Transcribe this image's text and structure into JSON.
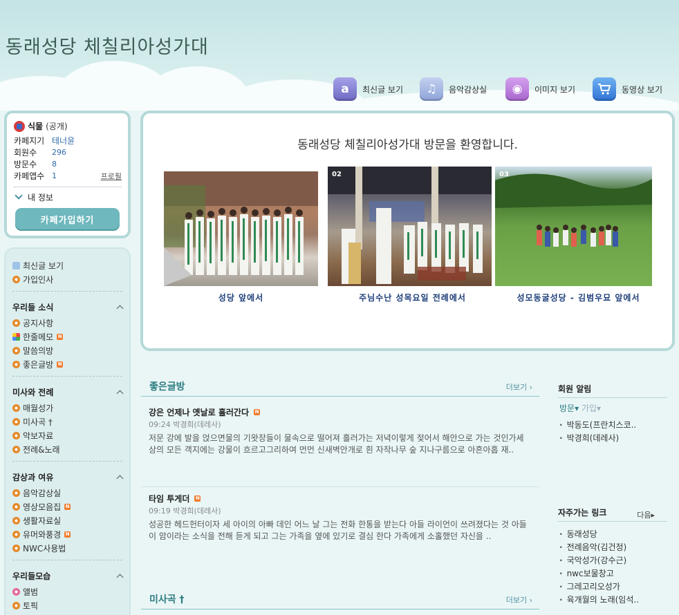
{
  "site": {
    "title": "동래성당 체칠리아성가대"
  },
  "topnav": [
    {
      "icon": "new-posts-icon",
      "glyph": "a",
      "color": "#7b78c9",
      "label": "최신글 보기"
    },
    {
      "icon": "music-note-icon",
      "glyph": "♫",
      "color": "#8fa6db",
      "label": "음악감상실"
    },
    {
      "icon": "camera-icon",
      "glyph": "◉",
      "color": "#b778d8",
      "label": "이미지 보기"
    },
    {
      "icon": "cart-icon",
      "glyph": "🛒",
      "color": "#4f8fe0",
      "label": "동영상 보기"
    }
  ],
  "profile": {
    "name": "식물",
    "visibility": "(공개)",
    "rows": [
      {
        "k": "카페지기",
        "v": "테너윤"
      },
      {
        "k": "회원수",
        "v": "296"
      },
      {
        "k": "방문수",
        "v": "8"
      },
      {
        "k": "카페앱수",
        "v": "1"
      }
    ],
    "profile_link": "프로필",
    "my_info": "내 정보",
    "join_label": "카페가입하기"
  },
  "menu": {
    "top_items": [
      {
        "label": "최신글 보기",
        "icon": "blue"
      },
      {
        "label": "가입인사",
        "icon": "orange"
      }
    ],
    "sections": [
      {
        "title": "우리들 소식",
        "items": [
          {
            "label": "공지사항",
            "icon": "orange",
            "new": false
          },
          {
            "label": "한줄메모",
            "icon": "multi",
            "new": true
          },
          {
            "label": "말씀의방",
            "icon": "orange",
            "new": false
          },
          {
            "label": "좋은글방",
            "icon": "orange",
            "new": true
          }
        ]
      },
      {
        "title": "미사와 전례",
        "items": [
          {
            "label": "매월성가",
            "icon": "orange",
            "new": false
          },
          {
            "label": "미사곡 †",
            "icon": "orange",
            "new": false
          },
          {
            "label": "악보자료",
            "icon": "orange",
            "new": false
          },
          {
            "label": "전례&노래",
            "icon": "orange",
            "new": false
          }
        ]
      },
      {
        "title": "감상과 여유",
        "items": [
          {
            "label": "음악감상실",
            "icon": "orange",
            "new": false
          },
          {
            "label": "영상모음집",
            "icon": "orange",
            "new": true
          },
          {
            "label": "생활자료실",
            "icon": "orange",
            "new": false
          },
          {
            "label": "유머와풍경",
            "icon": "orange",
            "new": true
          },
          {
            "label": "NWC사용법",
            "icon": "orange",
            "new": false
          }
        ]
      },
      {
        "title": "우리들모습",
        "items": [
          {
            "label": "앨범",
            "icon": "pink",
            "new": false
          },
          {
            "label": "토픽",
            "icon": "orange",
            "new": false
          }
        ]
      }
    ],
    "new_badge": "N"
  },
  "welcome": {
    "title": "동래성당 체칠리아성가대 방문을 환영합니다.",
    "photos": [
      {
        "num": "",
        "caption": "성당 앞에서"
      },
      {
        "num": "02",
        "caption": "주님수난 성목요일 전례에서"
      },
      {
        "num": "03",
        "caption": "성모동굴성당 - 김범우묘 앞에서"
      }
    ]
  },
  "boards": [
    {
      "title": "좋은글방",
      "more": "더보기 ›",
      "posts": [
        {
          "title": "강은 언제나 옛날로 흘러간다",
          "meta": "09:24  박경희(데레사)",
          "body": "저문 강에 발을 얹으면물의 기왓장들이 물속으로 떨어져 흘러가는 저녁이렇게 젖어서 해안으로 가는 것인가세상의 모든 객지에는 강물이 흐르고그리하여 먼먼 신새벽안개로 흰 자작나무 숲 지나구름으로 아흔아홉 재.."
        },
        {
          "title": "타임 투게더",
          "meta": "09:19  박경희(데레사)",
          "body": "성공한 헤드헌터이자 세 아이의 아빠 데인 어느 날 그는 전화 한통을 받는다 아들 라이언이 쓰려졌다는 것 아들이 암이라는 소식을 전해 듣게 되고 그는 가족을 옆에 있기로 결심 한다 가족에게 소홀했던 자신을 .."
        }
      ]
    },
    {
      "title": "미사곡 †",
      "more": "더보기 ›",
      "posts": []
    }
  ],
  "right": {
    "members_title": "회원 알림",
    "tab_visit": "방문▾",
    "tab_join": "가입▾",
    "members": [
      "박동도(프란치스코..",
      "박경희(데레사)"
    ],
    "links_title": "자주가는 링크",
    "links_next": "다음▸",
    "links": [
      "동래성당",
      "전례음악(김건정)",
      "국악성가(강수근)",
      "nwc보물창고",
      "그레고리오성가",
      "육개월의 노래(임석.."
    ]
  }
}
